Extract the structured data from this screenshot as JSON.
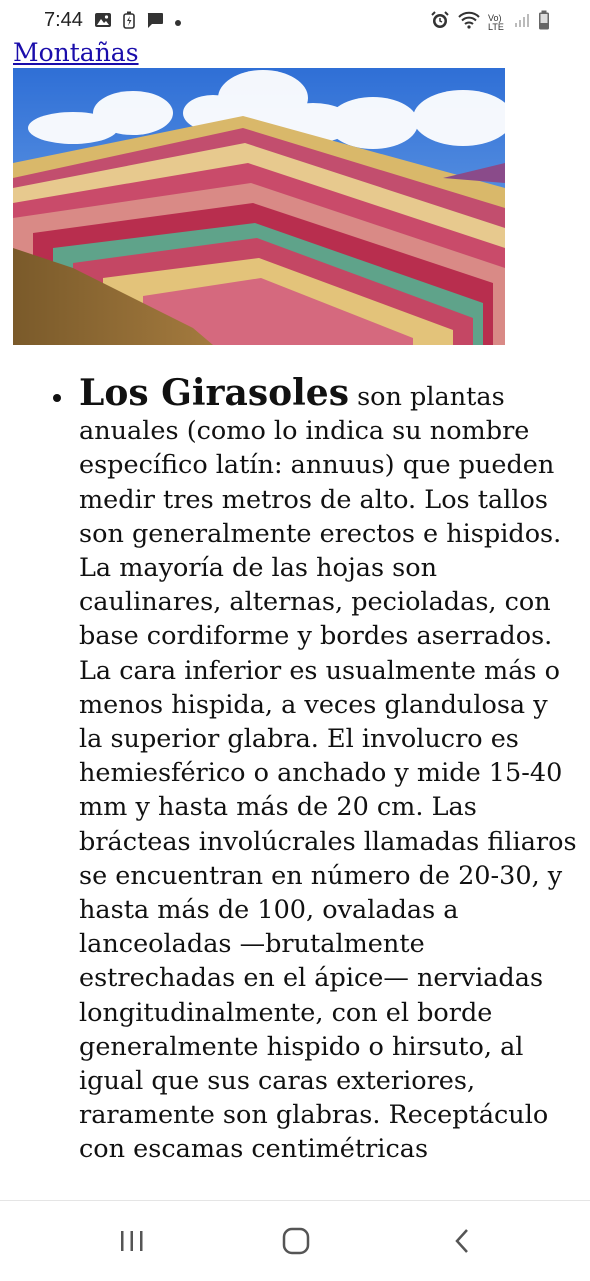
{
  "status_bar": {
    "time": "7:44",
    "left_icons": [
      "image-icon",
      "battery-saver-icon",
      "message-icon",
      "dot-icon"
    ],
    "right_icons": [
      "alarm-icon",
      "wifi-icon",
      "volte-icon",
      "signal-icon",
      "battery-icon"
    ],
    "volte_label": "Vo)\nLTE"
  },
  "page": {
    "link_text": "Montañas",
    "image_label": "rainbow-mountain-image",
    "list_item": {
      "title": "Los Girasoles",
      "text": " son plantas anuales (como lo indica su nombre específico latín: annuus) que pueden medir tres metros de alto. Los tallos son generalmente erectos e hispidos. La mayoría de las hojas son caulinares, alternas, pecioladas, con base cordiforme y bordes aserrados. La cara inferior es usualmente más o menos hispida, a veces glandulosa y la superior glabra. El involucro es hemiesférico o anchado y mide 15-40 mm y hasta más de 20 cm. Las brácteas involúcrales llamadas filiaros se encuentran en número de 20-30, y hasta más de 100, ovaladas a lanceoladas —brutalmente estrechadas en el ápice— nerviadas longitudinalmente, con el borde generalmente hispido o hirsuto, al igual que sus caras exteriores, raramente son glabras. Receptáculo con escamas centimétricas"
    }
  },
  "nav_bar": {
    "buttons": [
      "recents-icon",
      "home-icon",
      "back-icon"
    ]
  },
  "colors": {
    "link": "#1a0dab",
    "text": "#111111"
  }
}
